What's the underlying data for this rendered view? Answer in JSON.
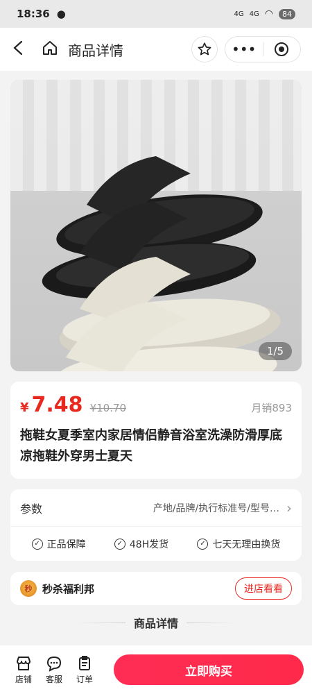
{
  "status": {
    "time": "18:36",
    "battery": "84",
    "net1": "4G",
    "net2": "4G"
  },
  "nav": {
    "title": "商品详情",
    "more_label": "•••"
  },
  "gallery": {
    "page_indicator": "1/5"
  },
  "product": {
    "currency": "¥",
    "price": "7.48",
    "original_price": "¥10.70",
    "sales": "月销893",
    "title": "拖鞋女夏季室内家居情侣静音浴室洗澡防滑厚底凉拖鞋外穿男士夏天"
  },
  "params": {
    "label": "参数",
    "value": "产地/品牌/执行标准号/型号…",
    "guarantees": [
      "正品保障",
      "48H发货",
      "七天无理由换货"
    ]
  },
  "shop": {
    "logo_text": "秒",
    "name": "秒杀福利邦",
    "button": "进店看看"
  },
  "detail": {
    "title": "商品详情"
  },
  "bottom": {
    "tabs": [
      {
        "icon": "shop-icon",
        "label": "店铺"
      },
      {
        "icon": "service-icon",
        "label": "客服"
      },
      {
        "icon": "order-icon",
        "label": "订单"
      }
    ],
    "buy_label": "立即购买"
  },
  "colors": {
    "accent": "#e8281f",
    "buy": "#ff2d55"
  }
}
